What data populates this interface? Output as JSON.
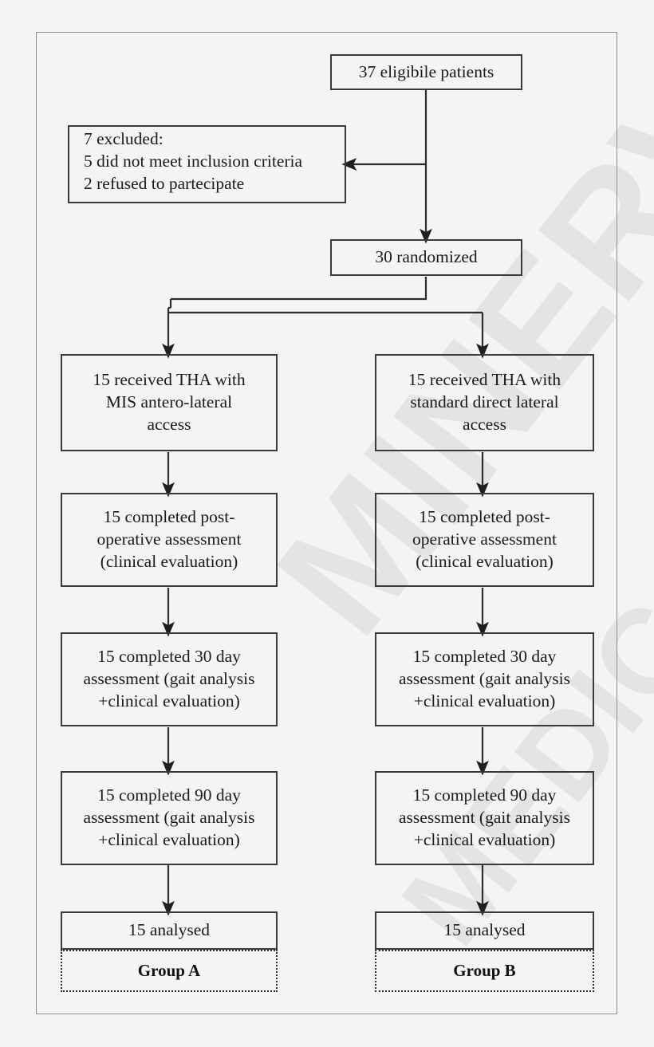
{
  "figure": {
    "type": "flowchart",
    "kind": "CONSORT participant flow diagram",
    "watermark": {
      "line1": "MINERVA",
      "line2": "MEDICA"
    },
    "colors": {
      "background": "#f4f4f4",
      "box_border": "#3a3a3a",
      "frame_border": "#8d8d8d",
      "text": "#1a1a1a",
      "watermark": "#e4e4e4"
    }
  },
  "nodes": {
    "eligible": {
      "label": "37 eligibile patients",
      "lines": [
        "37 eligibile patients"
      ]
    },
    "excluded": {
      "lines": [
        "7 excluded:",
        "5 did not meet inclusion criteria",
        "2 refused to partecipate"
      ]
    },
    "randomized": {
      "lines": [
        "30 randomized"
      ]
    },
    "arm_left": {
      "lines": [
        "15 received THA with",
        "MIS antero-lateral",
        "access"
      ]
    },
    "arm_right": {
      "lines": [
        "15 received THA with",
        "standard direct lateral",
        "access"
      ]
    },
    "postop_left": {
      "lines": [
        "15 completed post-",
        "operative assessment",
        "(clinical evaluation)"
      ]
    },
    "postop_right": {
      "lines": [
        "15 completed post-",
        "operative assessment",
        "(clinical evaluation)"
      ]
    },
    "day30_left": {
      "lines": [
        "15 completed 30 day",
        "assessment (gait analysis",
        "+clinical evaluation)"
      ]
    },
    "day30_right": {
      "lines": [
        "15 completed 30 day",
        "assessment (gait analysis",
        "+clinical evaluation)"
      ]
    },
    "day90_left": {
      "lines": [
        "15 completed 90 day",
        "assessment (gait analysis",
        "+clinical evaluation)"
      ]
    },
    "day90_right": {
      "lines": [
        "15 completed 90 day",
        "assessment (gait analysis",
        "+clinical evaluation)"
      ]
    },
    "analysed_left": {
      "lines": [
        "15 analysed"
      ]
    },
    "analysed_right": {
      "lines": [
        "15 analysed"
      ]
    },
    "group_left": {
      "label": "Group A"
    },
    "group_right": {
      "label": "Group B"
    }
  }
}
